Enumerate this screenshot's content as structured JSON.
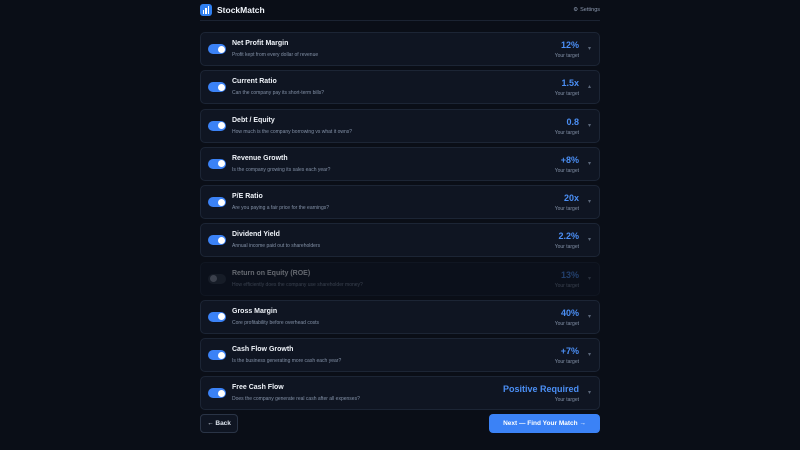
{
  "app": {
    "name": "StockMatch",
    "settings_label": "Settings",
    "settings_icon": "gear-icon"
  },
  "metrics": [
    {
      "title": "Net Profit Margin",
      "desc": "Profit kept from every dollar of revenue",
      "value": "12%",
      "target_label": "Your target",
      "enabled": true
    },
    {
      "title": "Current Ratio",
      "desc": "Can the company pay its short-term bills?",
      "value": "1.5x",
      "target_label": "Your target",
      "enabled": true
    },
    {
      "title": "Debt / Equity",
      "desc": "How much is the company borrowing vs what it owns?",
      "value": "0.8",
      "target_label": "Your target",
      "enabled": true
    },
    {
      "title": "Revenue Growth",
      "desc": "Is the company growing its sales each year?",
      "value": "+8%",
      "target_label": "Your target",
      "enabled": true
    },
    {
      "title": "P/E Ratio",
      "desc": "Are you paying a fair price for the earnings?",
      "value": "20x",
      "target_label": "Your target",
      "enabled": true
    },
    {
      "title": "Dividend Yield",
      "desc": "Annual income paid out to shareholders",
      "value": "2.2%",
      "target_label": "Your target",
      "enabled": true
    },
    {
      "title": "Return on Equity (ROE)",
      "desc": "How efficiently does the company use shareholder money?",
      "value": "13%",
      "target_label": "Your target",
      "enabled": false
    },
    {
      "title": "Gross Margin",
      "desc": "Core profitability before overhead costs",
      "value": "40%",
      "target_label": "Your target",
      "enabled": true
    },
    {
      "title": "Cash Flow Growth",
      "desc": "Is the business generating more cash each year?",
      "value": "+7%",
      "target_label": "Your target",
      "enabled": true
    },
    {
      "title": "Free Cash Flow",
      "desc": "Does the company generate real cash after all expenses?",
      "value": "Positive Required",
      "target_label": "Your target",
      "enabled": true
    }
  ],
  "footer": {
    "back_label": "← Back",
    "next_label": "Next — Find Your Match →"
  },
  "colors": {
    "accent": "#3b82f6",
    "background": "#0a0e17",
    "card": "#0f1522"
  }
}
